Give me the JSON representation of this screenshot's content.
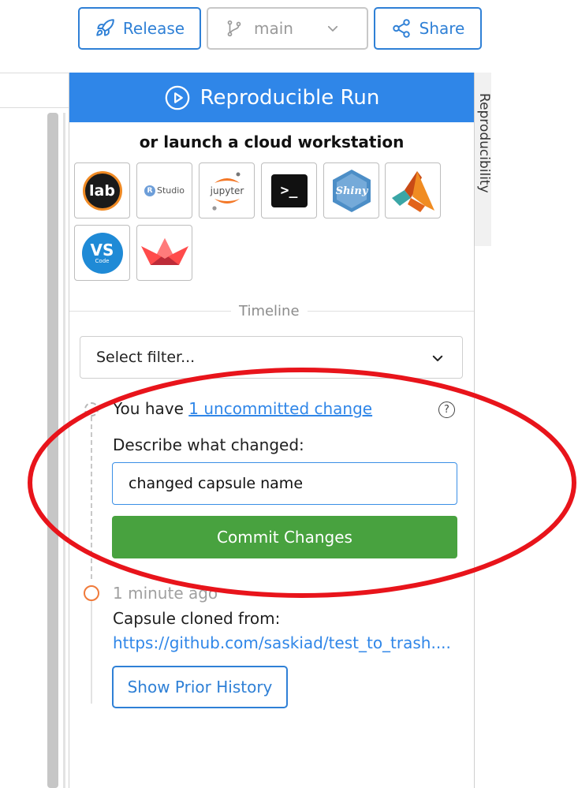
{
  "toolbar": {
    "release_label": "Release",
    "branch_value": "main",
    "share_label": "Share"
  },
  "right_rail": {
    "label": "Reproducibility"
  },
  "panel": {
    "run_button_label": "Reproducible Run",
    "launch_title": "or launch a cloud workstation",
    "workstations": [
      {
        "name": "jupyterlab",
        "text": "lab"
      },
      {
        "name": "rstudio",
        "text": "Studio",
        "badge": "R"
      },
      {
        "name": "jupyter",
        "text": "jupyter"
      },
      {
        "name": "terminal",
        "text": ">_"
      },
      {
        "name": "shiny",
        "text": "Shiny"
      },
      {
        "name": "matlab",
        "text": ""
      },
      {
        "name": "vscode",
        "text": "VS",
        "subtext": "Code"
      },
      {
        "name": "streamlit",
        "text": ""
      }
    ],
    "timeline_label": "Timeline",
    "filter_placeholder": "Select filter...",
    "uncommitted_prefix": "You have ",
    "uncommitted_link": "1 uncommitted change",
    "help_icon_text": "?",
    "describe_label": "Describe what changed:",
    "commit_message_value": "changed capsule name",
    "commit_button_label": "Commit Changes",
    "history_time": "1 minute ago",
    "cloned_label": "Capsule cloned from:",
    "cloned_url": "https://github.com/saskiad/test_to_trash....",
    "prior_history_label": "Show Prior History"
  },
  "colors": {
    "accent_blue": "#2f86e8",
    "commit_green": "#48a23f",
    "annotation_red": "#e8141b",
    "timeline_orange": "#f07a3a"
  }
}
